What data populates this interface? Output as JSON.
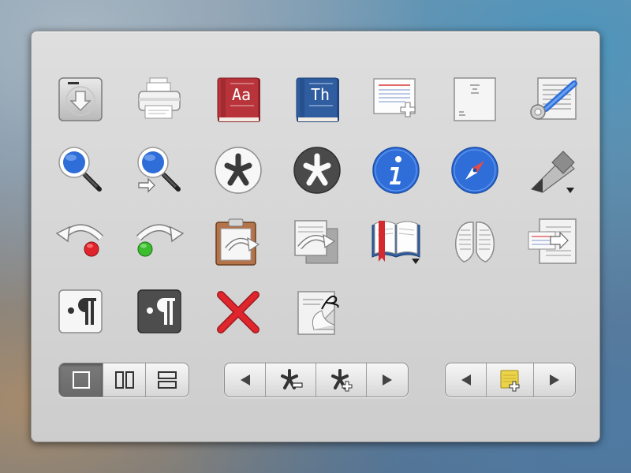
{
  "dictionary_icons": {
    "red_book_text": "Aa",
    "blue_book_text": "Th"
  },
  "colors": {
    "blue_accent": "#2f6ed8",
    "red_book": "#b8343a",
    "blue_book": "#2f5da0",
    "red_dot": "#e0242b",
    "green_dot": "#3bbd2e",
    "red_x": "#e0262c",
    "active_segment": "#6f6f6f"
  },
  "icons": [
    "disk-download-icon",
    "printer-icon",
    "red-dictionary-icon",
    "blue-thesaurus-icon",
    "new-document-icon",
    "document-icon",
    "document-settings-icon",
    "search-icon",
    "search-next-icon",
    "asterisk-light-icon",
    "asterisk-dark-icon",
    "info-icon",
    "compass-icon",
    "highlighter-icon",
    "undo-icon",
    "redo-icon",
    "clipboard-icon",
    "copy-icon",
    "open-book-icon",
    "shells-icon",
    "export-icon",
    "paragraph-light-icon",
    "paragraph-dark-icon",
    "delete-icon",
    "sign-document-icon"
  ],
  "segmented_controls": {
    "layout": [
      "single-page-icon",
      "two-column-icon",
      "two-row-icon"
    ],
    "asterisk_nav": [
      "left-arrow-icon",
      "asterisk-minus-icon",
      "asterisk-plus-icon",
      "right-arrow-icon"
    ],
    "note_nav": [
      "left-arrow-icon",
      "note-add-icon",
      "right-arrow-icon"
    ]
  }
}
